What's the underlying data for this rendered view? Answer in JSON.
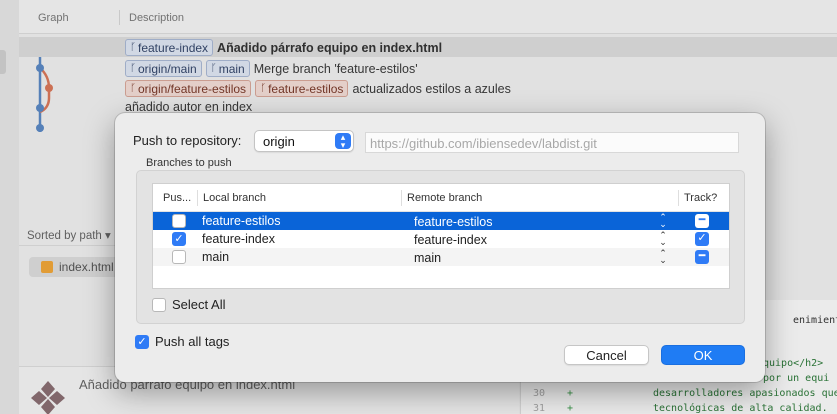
{
  "background": {
    "columns": {
      "graph": "Graph",
      "description": "Description"
    },
    "commits": [
      {
        "tags": [
          {
            "label": "feature-index",
            "color": "blue"
          }
        ],
        "message": "Añadido párrafo equipo en index.html",
        "bold": true
      },
      {
        "tags": [
          {
            "label": "origin/main",
            "color": "blue"
          },
          {
            "label": "main",
            "color": "blue"
          }
        ],
        "message": "Merge branch 'feature-estilos'"
      },
      {
        "tags": [
          {
            "label": "origin/feature-estilos",
            "color": "red"
          },
          {
            "label": "feature-estilos",
            "color": "red"
          }
        ],
        "message": "actualizados estilos a azules"
      },
      {
        "tags": [],
        "message": "añadido autor en index"
      }
    ],
    "sorted_by": "Sorted by path",
    "file": "index.html",
    "commit_title": "Añadido párrafo equipo en index.html",
    "code_fragments": {
      "top_right": "enimiento cor",
      "lines": [
        {
          "num": "",
          "text": "quipo</h2>"
        },
        {
          "num": "",
          "text": "o por un equi"
        },
        {
          "num": "30",
          "text": "desarrolladores apasionados que"
        },
        {
          "num": "31",
          "text": "tecnológicas de alta calidad."
        }
      ]
    }
  },
  "dialog": {
    "push_to_repository_label": "Push to repository:",
    "repository": "origin",
    "repository_url": "https://github.com/ibiensedev/labdist.git",
    "branches_label": "Branches to push",
    "columns": {
      "push": "Pus...",
      "local": "Local branch",
      "remote": "Remote branch",
      "track": "Track?"
    },
    "branches": [
      {
        "push": false,
        "local": "feature-estilos",
        "remote": "feature-estilos",
        "track": "mixed",
        "selected": true
      },
      {
        "push": true,
        "local": "feature-index",
        "remote": "feature-index",
        "track": "checked",
        "selected": false
      },
      {
        "push": false,
        "local": "main",
        "remote": "main",
        "track": "mixed",
        "selected": false
      }
    ],
    "select_all": "Select All",
    "push_all_tags": "Push all tags",
    "push_all_tags_checked": true,
    "cancel": "Cancel",
    "ok": "OK",
    "accent_color": "#2f7bf6",
    "selection_color": "#0a64d8"
  }
}
